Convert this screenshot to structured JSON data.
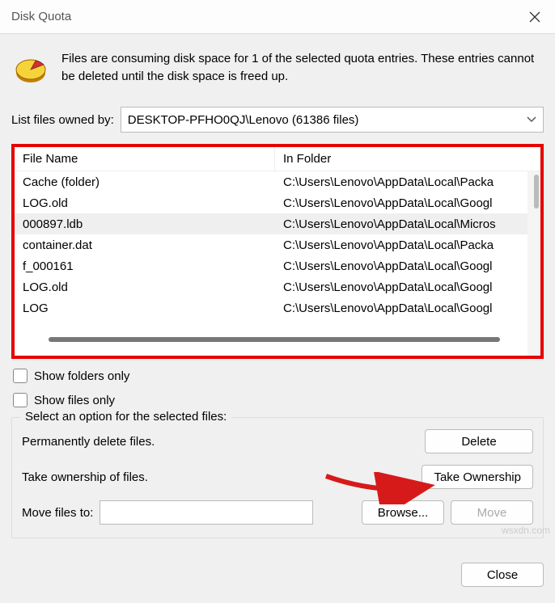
{
  "title": "Disk Quota",
  "info": "Files are consuming disk space for 1 of the selected quota entries.  These entries cannot be deleted until the disk space is freed up.",
  "owned_label": "List files owned by:",
  "owned_value": "DESKTOP-PFHO0QJ\\Lenovo (61386 files)",
  "columns": {
    "name": "File Name",
    "folder": "In Folder"
  },
  "files": [
    {
      "name": "Cache  (folder)",
      "folder": "C:\\Users\\Lenovo\\AppData\\Local\\Packa",
      "selected": false
    },
    {
      "name": "LOG.old",
      "folder": "C:\\Users\\Lenovo\\AppData\\Local\\Googl",
      "selected": false
    },
    {
      "name": "000897.ldb",
      "folder": "C:\\Users\\Lenovo\\AppData\\Local\\Micros",
      "selected": true
    },
    {
      "name": "container.dat",
      "folder": "C:\\Users\\Lenovo\\AppData\\Local\\Packa",
      "selected": false
    },
    {
      "name": "f_000161",
      "folder": "C:\\Users\\Lenovo\\AppData\\Local\\Googl",
      "selected": false
    },
    {
      "name": "LOG.old",
      "folder": "C:\\Users\\Lenovo\\AppData\\Local\\Googl",
      "selected": false
    },
    {
      "name": "LOG",
      "folder": "C:\\Users\\Lenovo\\AppData\\Local\\Googl",
      "selected": false
    }
  ],
  "check_folders": "Show folders only",
  "check_files": "Show files only",
  "group_label": "Select an option for the selected files:",
  "perm_delete": "Permanently delete files.",
  "take_owner_text": "Take ownership of files.",
  "move_label": "Move files to:",
  "buttons": {
    "delete": "Delete",
    "take": "Take Ownership",
    "browse": "Browse...",
    "move": "Move",
    "close": "Close"
  },
  "watermark": "wsxdn.com"
}
